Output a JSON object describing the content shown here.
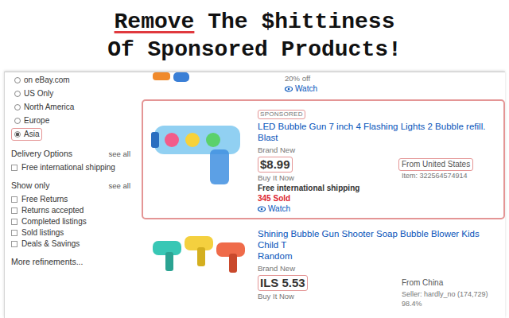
{
  "banner": {
    "lines": [
      [
        {
          "text": "Remove",
          "underlined": true
        },
        {
          "text": " The $hittiness",
          "underlined": false
        }
      ],
      [
        {
          "text": "Of Sponsored Products!",
          "underlined": false
        }
      ]
    ]
  },
  "sidebar": {
    "locations": [
      {
        "label": "on eBay.com",
        "selected": false,
        "highlighted": false
      },
      {
        "label": "US Only",
        "selected": false,
        "highlighted": false
      },
      {
        "label": "North America",
        "selected": false,
        "highlighted": false
      },
      {
        "label": "Europe",
        "selected": false,
        "highlighted": false
      },
      {
        "label": "Asia",
        "selected": true,
        "highlighted": true
      }
    ],
    "groups": [
      {
        "title": "Delivery Options",
        "link": "see all",
        "options": [
          {
            "label": "Free international shipping",
            "checked": false
          }
        ]
      },
      {
        "title": "Show only",
        "link": "see all",
        "options": [
          {
            "label": "Free Returns",
            "checked": false
          },
          {
            "label": "Returns accepted",
            "checked": false
          },
          {
            "label": "Completed listings",
            "checked": false
          },
          {
            "label": "Sold listings",
            "checked": false
          },
          {
            "label": "Deals & Savings",
            "checked": false
          }
        ]
      }
    ],
    "more": "More refinements..."
  },
  "listings": [
    {
      "kind": "partial",
      "discount": "20% off",
      "watch": "Watch"
    },
    {
      "kind": "full",
      "highlighted": true,
      "badge": {
        "text": "SPONSORED",
        "highlighted": true
      },
      "title_lines": [
        "LED Bubble Gun 7 inch 4 Flashing Lights 2 Bubble refill. Blast"
      ],
      "condition": "Brand New",
      "price": {
        "text": "$8.99",
        "highlighted": true
      },
      "format": "Buy It Now",
      "shipping": "Free international shipping",
      "sold": "345 Sold",
      "watch": "Watch",
      "origin": {
        "text": "From United States",
        "highlighted": true
      },
      "meta": "Item: 322564574914"
    },
    {
      "kind": "full",
      "highlighted": false,
      "badge": null,
      "title_lines": [
        "Shining Bubble Gun Shooter Soap Bubble Blower Kids Child T",
        "Random"
      ],
      "condition": "Brand New",
      "price": {
        "text": "ILS 5.53",
        "highlighted": true
      },
      "format": "Buy It Now",
      "shipping": null,
      "sold": null,
      "watch": null,
      "origin": {
        "text": "From China",
        "highlighted": false
      },
      "meta": "Seller: hardly_no (174,729) 98.4%"
    }
  ]
}
